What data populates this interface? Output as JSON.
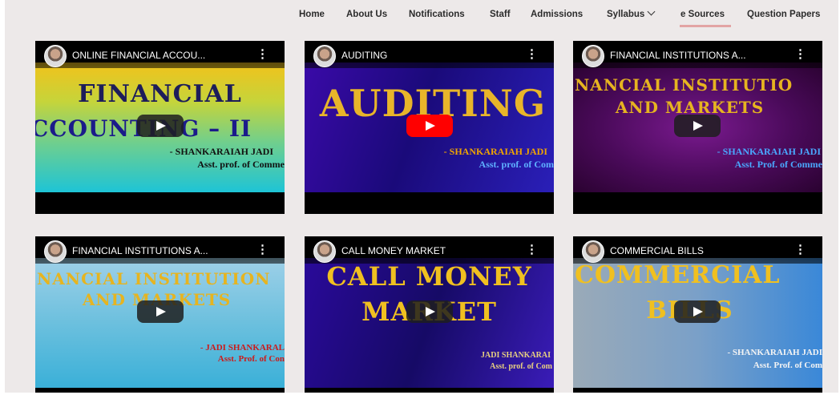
{
  "nav": {
    "items": [
      "Home",
      "About Us",
      "Notifications",
      "Staff",
      "Admissions",
      "Syllabus",
      "e Sources",
      "Question Papers"
    ],
    "active": "e Sources"
  },
  "videos": [
    {
      "title": "ONLINE FINANCIAL ACCOU...",
      "thumb_line1": "FINANCIAL",
      "thumb_line2": "CCOUNTING – II",
      "thumb_sub1": "- SHANKARAIAH JADI",
      "thumb_sub2": "Asst. prof. of Comme"
    },
    {
      "title": "AUDITING",
      "thumb_line1": "AUDITING",
      "thumb_sub1": "- SHANKARAIAH JADI",
      "thumb_sub2": "Asst. prof. of Com"
    },
    {
      "title": "FINANCIAL INSTITUTIONS A...",
      "thumb_line1": "NANCIAL INSTITUTIO",
      "thumb_line2": "AND MARKETS",
      "thumb_sub1": "- SHANKARAIAH JADI",
      "thumb_sub2": "Asst. Prof. of Comme"
    },
    {
      "title": "FINANCIAL INSTITUTIONS A...",
      "thumb_line1": "NANCIAL INSTITUTION",
      "thumb_line2": "AND MARKETS",
      "thumb_sub1": "- JADI SHANKARAL",
      "thumb_sub2": "Asst. Prof. of Con"
    },
    {
      "title": "CALL MONEY MARKET",
      "thumb_line1": "CALL MONEY",
      "thumb_line2": "MARKET",
      "thumb_sub1": "JADI SHANKARAI",
      "thumb_sub2": "Asst. prof. of Com"
    },
    {
      "title": "COMMERCIAL BILLS",
      "thumb_line1": "COMMERCIAL",
      "thumb_line2": "BILLS",
      "thumb_sub1": "- SHANKARAIAH JADI",
      "thumb_sub2": "Asst. Prof. of Com"
    }
  ],
  "icons": {
    "play": "play-icon",
    "menu": "more-vert-icon",
    "avatar": "channel-avatar"
  },
  "colors": {
    "active_underline": "#e2a4a4",
    "youtube_red": "#ff0000"
  }
}
